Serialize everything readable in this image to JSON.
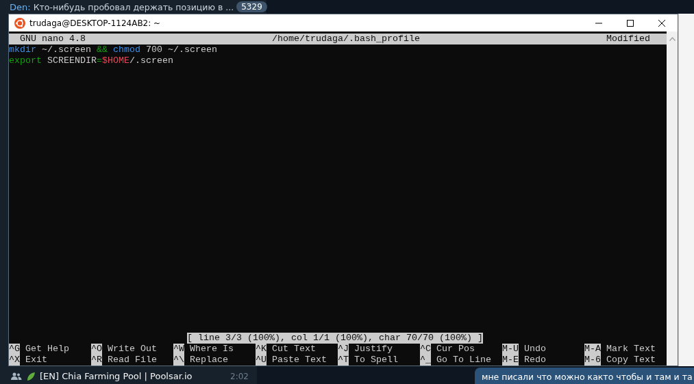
{
  "background_chat": {
    "top_item": {
      "sender": "Den:",
      "message": "Кто-нибудь пробовал держать позицию в ...",
      "unread": "5329"
    },
    "bottom_item": {
      "name": "[EN] Chia Farming Pool | Poolsar.io",
      "time": "2:02"
    },
    "message_bubble": "мне писали что можно както чтобы и там и та"
  },
  "window": {
    "title": "trudaga@DESKTOP-1124AB2: ~"
  },
  "nano": {
    "version": "GNU nano 4.8",
    "file": "/home/trudaga/.bash_profile",
    "state": "Modified",
    "lines": [
      [
        {
          "text": "mkdir",
          "kind": "command"
        },
        {
          "text": " ~/.screen ",
          "kind": "plain"
        },
        {
          "text": "&&",
          "kind": "operator"
        },
        {
          "text": " chmod",
          "kind": "command"
        },
        {
          "text": " 700 ~/.screen",
          "kind": "plain"
        }
      ],
      [
        {
          "text": "export",
          "kind": "operator"
        },
        {
          "text": " SCREENDIR",
          "kind": "plain"
        },
        {
          "text": "=",
          "kind": "operator"
        },
        {
          "text": "$HOME",
          "kind": "variable"
        },
        {
          "text": "/.screen",
          "kind": "plain"
        }
      ]
    ],
    "status": "[ line 3/3 (100%), col 1/1 (100%), char 70/70 (100%) ]",
    "shortcut_rows": [
      [
        {
          "key": "^G",
          "label": "Get Help"
        },
        {
          "key": "^O",
          "label": "Write Out"
        },
        {
          "key": "^W",
          "label": "Where Is"
        },
        {
          "key": "^K",
          "label": "Cut Text"
        },
        {
          "key": "^J",
          "label": "Justify"
        },
        {
          "key": "^C",
          "label": "Cur Pos"
        },
        {
          "key": "M-U",
          "label": "Undo"
        },
        {
          "key": "M-A",
          "label": "Mark Text"
        }
      ],
      [
        {
          "key": "^X",
          "label": "Exit"
        },
        {
          "key": "^R",
          "label": "Read File"
        },
        {
          "key": "^\\",
          "label": "Replace"
        },
        {
          "key": "^U",
          "label": "Paste Text"
        },
        {
          "key": "^T",
          "label": "To Spell"
        },
        {
          "key": "^_",
          "label": "Go To Line"
        },
        {
          "key": "M-E",
          "label": "Redo"
        },
        {
          "key": "M-6",
          "label": "Copy Text"
        }
      ]
    ]
  }
}
